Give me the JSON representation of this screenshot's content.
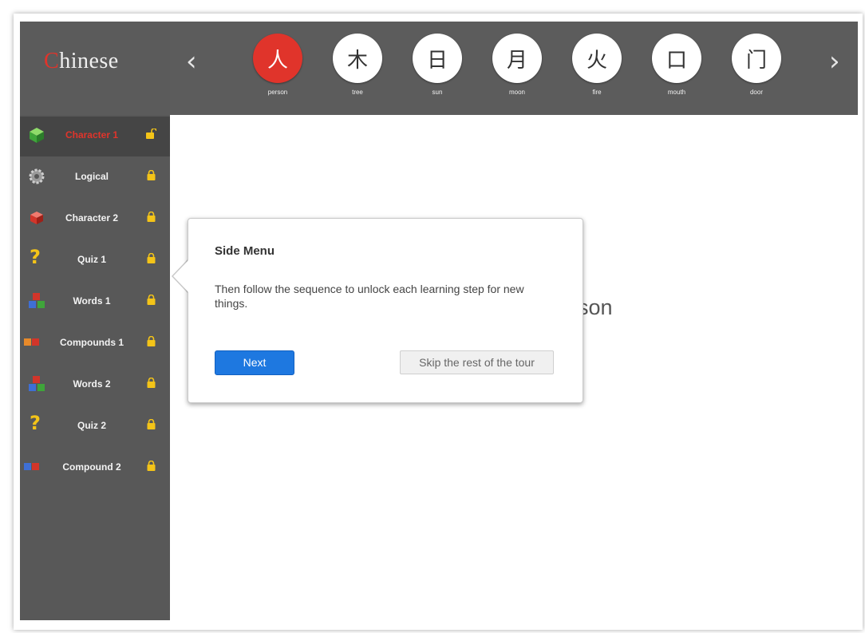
{
  "app": {
    "logo_first": "C",
    "logo_rest": "hinese"
  },
  "topbar": {
    "prev_icon": "‹",
    "next_icon": "›",
    "characters": [
      {
        "glyph": "人",
        "label": "person",
        "active": true
      },
      {
        "glyph": "木",
        "label": "tree"
      },
      {
        "glyph": "日",
        "label": "sun"
      },
      {
        "glyph": "月",
        "label": "moon"
      },
      {
        "glyph": "火",
        "label": "fire"
      },
      {
        "glyph": "口",
        "label": "mouth"
      },
      {
        "glyph": "门",
        "label": "door"
      }
    ]
  },
  "sidebar": {
    "items": [
      {
        "label": "Character 1",
        "icon": "green-cube-icon",
        "lock": "unlocked-icon",
        "active": true
      },
      {
        "label": "Logical",
        "icon": "gear-icon",
        "lock": "lock-icon"
      },
      {
        "label": "Character 2",
        "icon": "red-cube-icon",
        "lock": "lock-icon"
      },
      {
        "label": "Quiz 1",
        "icon": "question-mark-icon",
        "lock": "lock-icon"
      },
      {
        "label": "Words 1",
        "icon": "cubes-stack-icon",
        "lock": "lock-icon"
      },
      {
        "label": "Compounds 1",
        "icon": "cubes-pair-icon",
        "lock": "lock-icon"
      },
      {
        "label": "Words 2",
        "icon": "cubes-stack-icon",
        "lock": "lock-icon"
      },
      {
        "label": "Quiz 2",
        "icon": "question-mark-icon",
        "lock": "lock-icon"
      },
      {
        "label": "Compound 2",
        "icon": "cubes-pair-icon",
        "lock": "lock-icon"
      }
    ]
  },
  "main": {
    "word": "erson"
  },
  "tour": {
    "title": "Side Menu",
    "body": "Then follow the sequence to unlock each learning step for new things.",
    "next_label": "Next",
    "skip_label": "Skip the rest of the tour"
  },
  "colors": {
    "accent": "#e0342b",
    "button_blue": "#1e78e0",
    "sidebar_bg": "#585858",
    "lock_yellow": "#f4c418"
  }
}
